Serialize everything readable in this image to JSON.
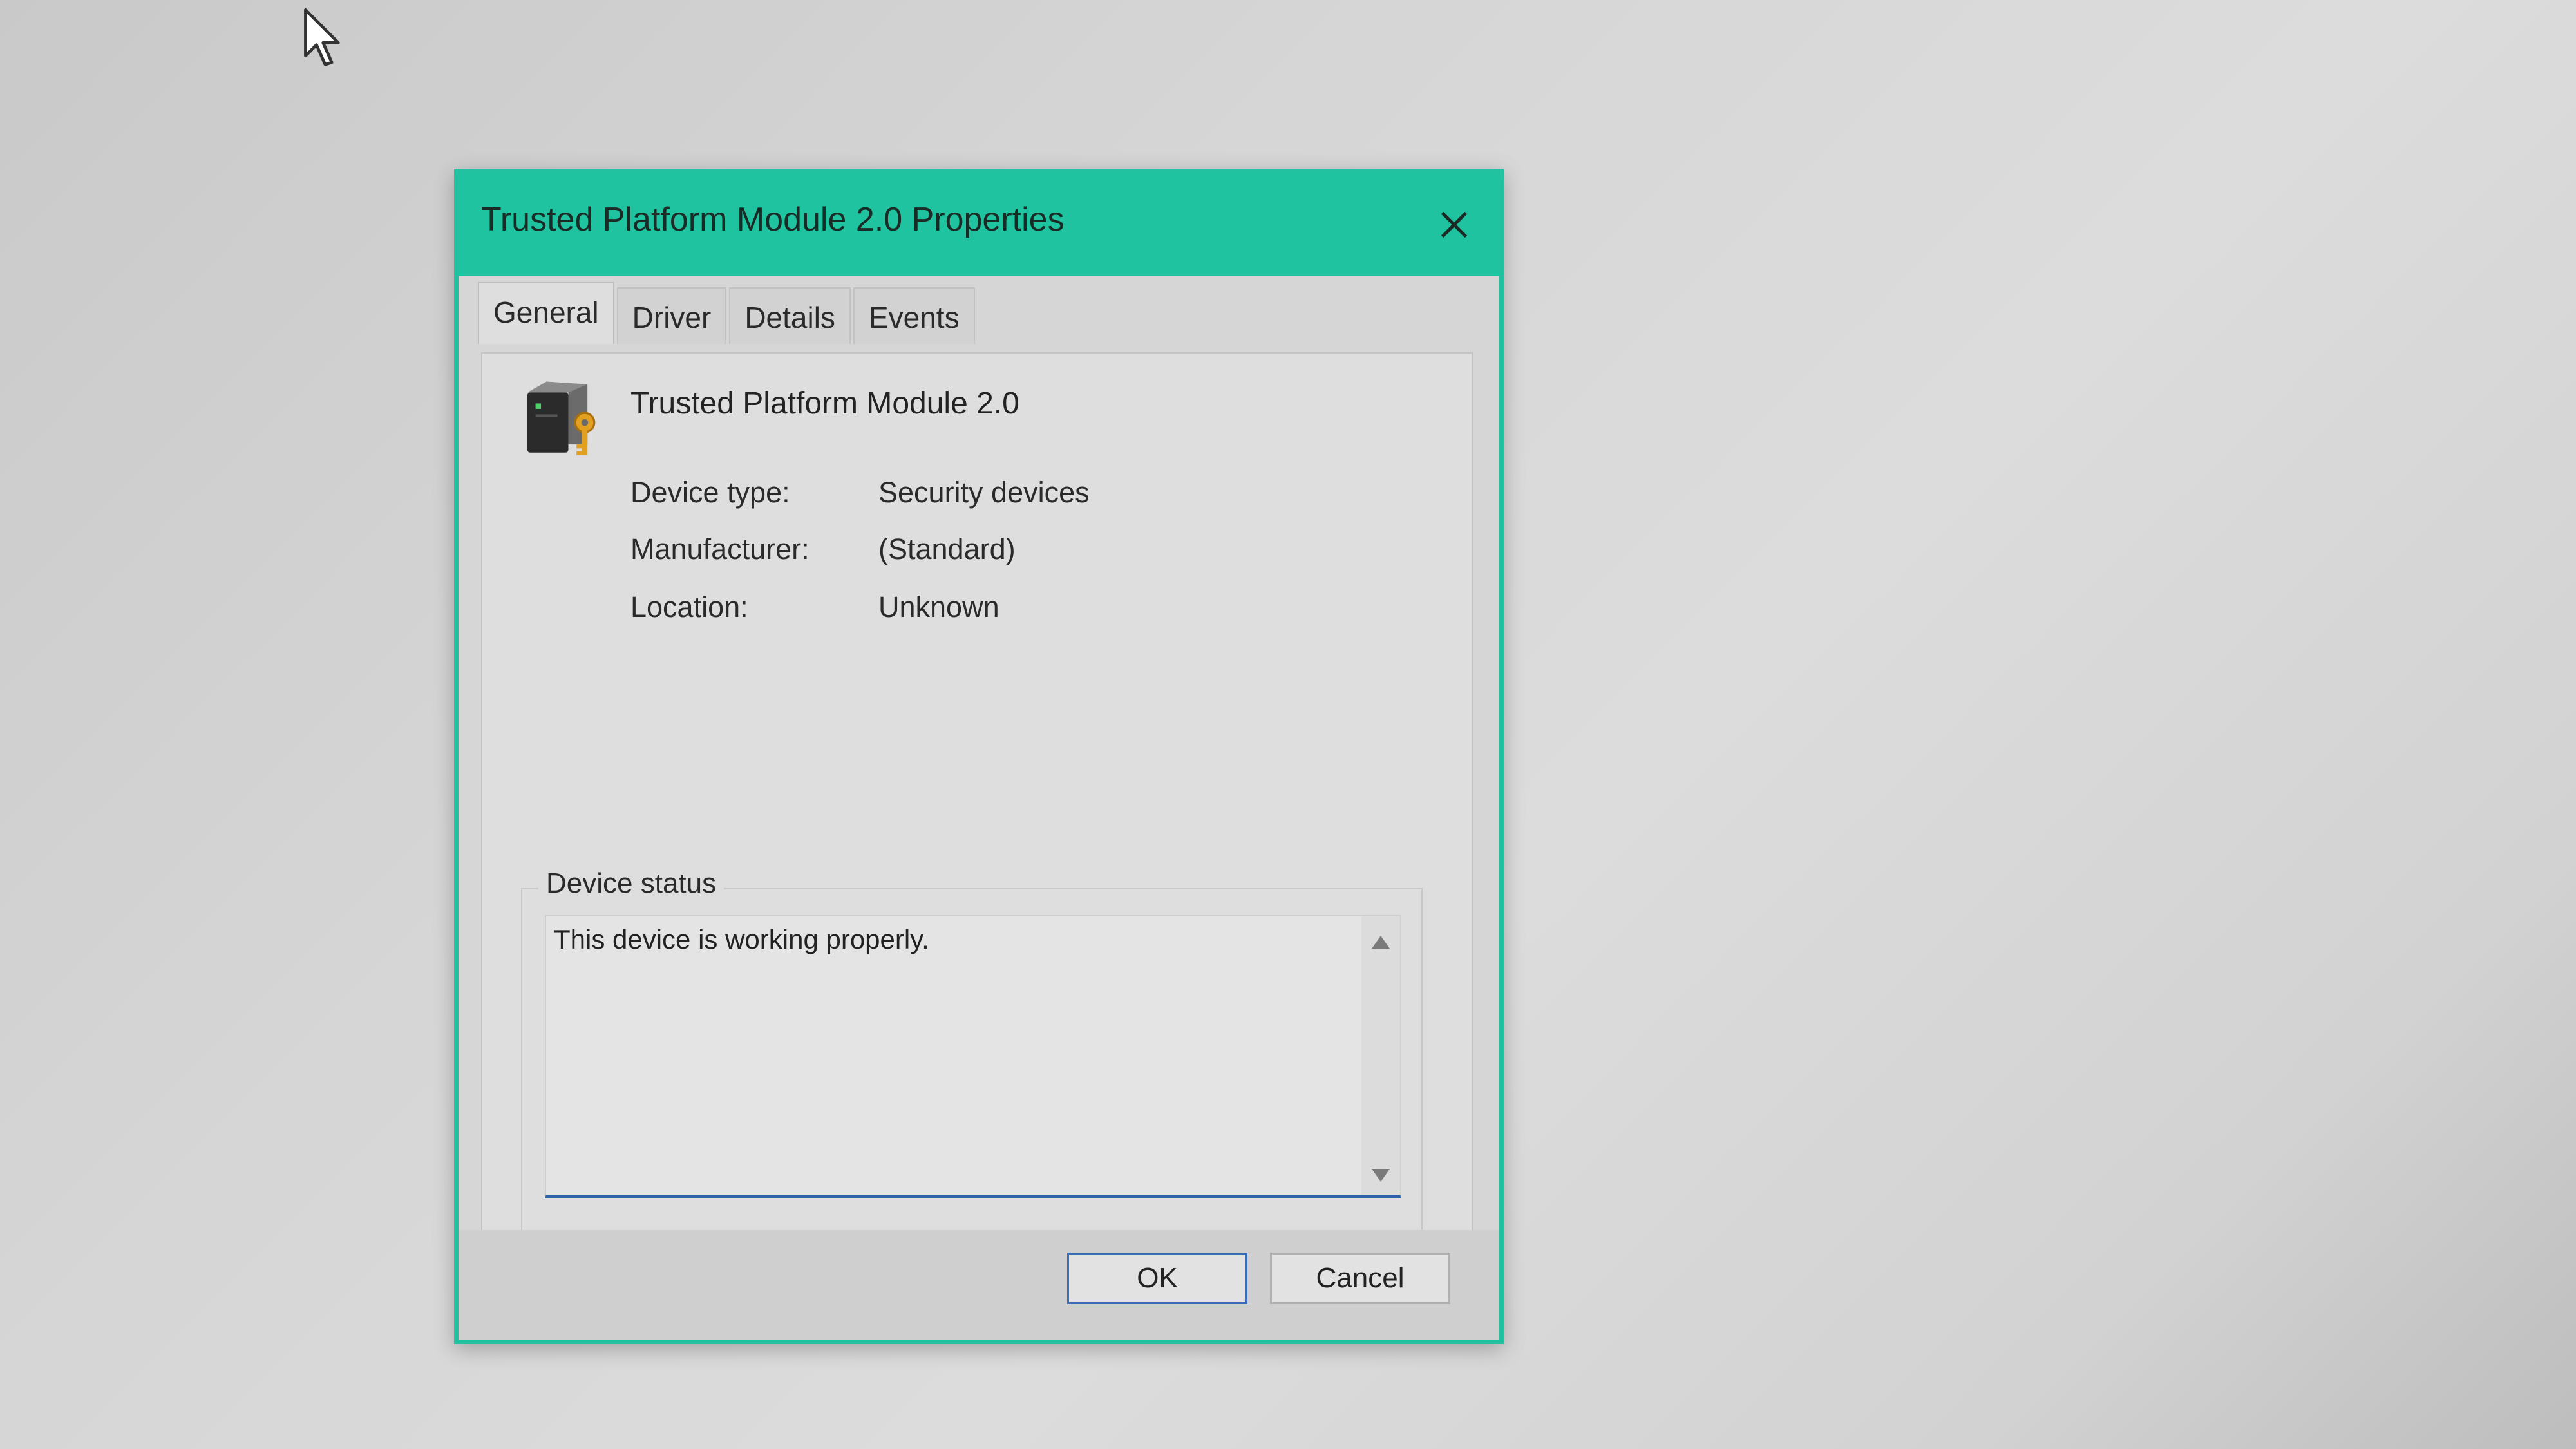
{
  "window": {
    "title": "Trusted Platform Module 2.0 Properties"
  },
  "tabs": [
    {
      "label": "General"
    },
    {
      "label": "Driver"
    },
    {
      "label": "Details"
    },
    {
      "label": "Events"
    }
  ],
  "device": {
    "name": "Trusted Platform Module 2.0",
    "icon": "tpm-device-icon"
  },
  "properties": [
    {
      "label": "Device type:",
      "value": "Security devices"
    },
    {
      "label": "Manufacturer:",
      "value": "(Standard)"
    },
    {
      "label": "Location:",
      "value": "Unknown"
    }
  ],
  "status": {
    "legend": "Device status",
    "text": "This device is working properly."
  },
  "buttons": {
    "ok": "OK",
    "cancel": "Cancel"
  },
  "colors": {
    "accent": "#1fc3a0",
    "focus": "#2f5fa8"
  }
}
